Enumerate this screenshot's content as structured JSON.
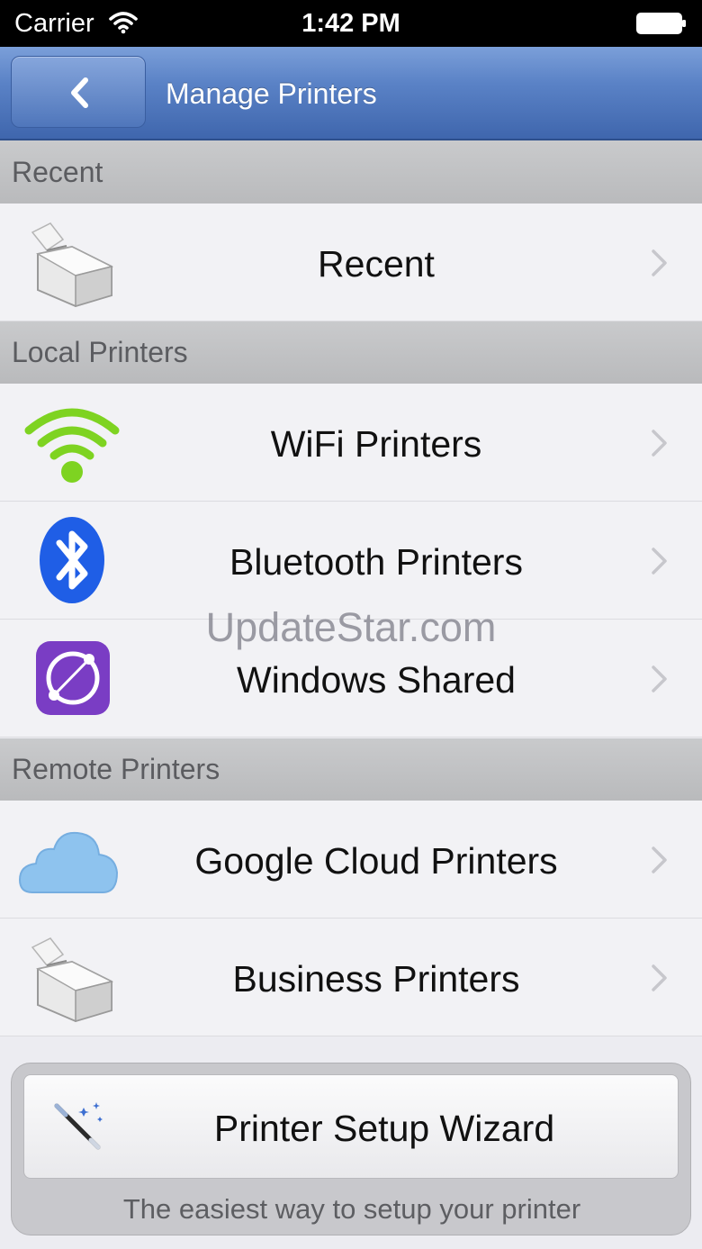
{
  "status_bar": {
    "carrier": "Carrier",
    "time": "1:42 PM",
    "icons": [
      "wifi-icon",
      "battery-icon"
    ]
  },
  "nav": {
    "title": "Manage Printers",
    "back_icon": "chevron-left-icon"
  },
  "sections": [
    {
      "header": "Recent",
      "rows": [
        {
          "label": "Recent",
          "icon": "printer-icon"
        }
      ]
    },
    {
      "header": "Local Printers",
      "rows": [
        {
          "label": "WiFi Printers",
          "icon": "wifi-icon"
        },
        {
          "label": "Bluetooth Printers",
          "icon": "bluetooth-icon"
        },
        {
          "label": "Windows Shared",
          "icon": "network-share-icon"
        }
      ]
    },
    {
      "header": "Remote Printers",
      "rows": [
        {
          "label": "Google Cloud Printers",
          "icon": "cloud-icon"
        },
        {
          "label": "Business Printers",
          "icon": "printer-icon"
        }
      ]
    }
  ],
  "watermark": "UpdateStar.com",
  "wizard": {
    "label": "Printer Setup Wizard",
    "caption": "The easiest way to setup your printer",
    "icon": "magic-wand-icon"
  },
  "colors": {
    "nav_bar": "#4f76bb",
    "section_header": "#c1c2c4",
    "row_background": "#f2f2f5",
    "wifi_green": "#7ed321",
    "bluetooth_blue": "#1f5ee6",
    "windows_shared_purple": "#7a3dc4",
    "cloud_blue": "#8ec3ee"
  }
}
